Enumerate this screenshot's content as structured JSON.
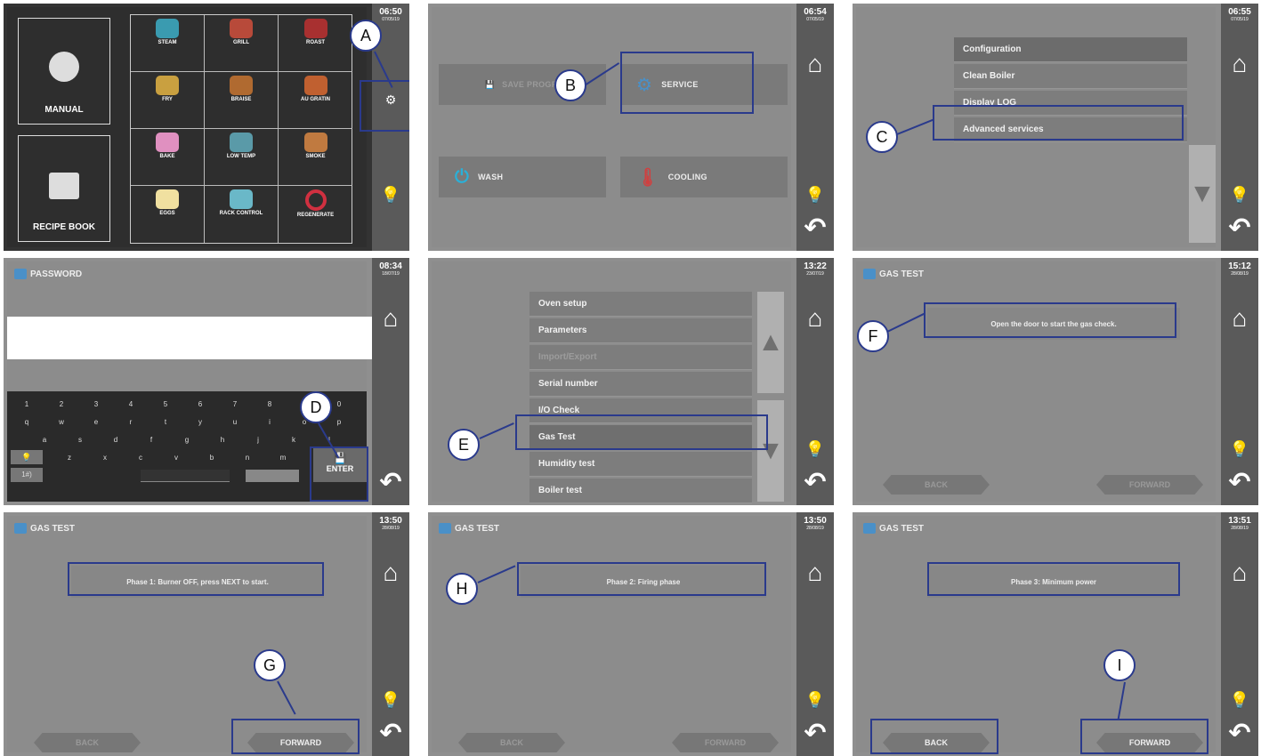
{
  "panel_a": {
    "clock": "06:50",
    "date": "07/05/19",
    "manual_label": "MANUAL",
    "recipe_label": "RECIPE BOOK",
    "cells": [
      "STEAM",
      "GRILL",
      "ROAST",
      "FRY",
      "BRAISE",
      "AU GRATIN",
      "BAKE",
      "LOW TEMP",
      "SMOKE",
      "EGGS",
      "RACK CONTROL",
      "REGENERATE"
    ],
    "callout": "A"
  },
  "panel_b": {
    "clock": "06:54",
    "date": "07/05/19",
    "save_label": "SAVE PROGR.",
    "service_label": "SERVICE",
    "wash_label": "WASH",
    "cooling_label": "COOLING",
    "callout": "B"
  },
  "panel_c": {
    "clock": "06:55",
    "date": "07/05/19",
    "items": [
      "Configuration",
      "Clean Boiler",
      "Display LOG",
      "Advanced services"
    ],
    "callout": "C"
  },
  "panel_d": {
    "clock": "08:34",
    "date": "18/07/19",
    "title": "PASSWORD",
    "row1": [
      "1",
      "2",
      "3",
      "4",
      "5",
      "6",
      "7",
      "8",
      "9",
      "0"
    ],
    "row2": [
      "q",
      "w",
      "e",
      "r",
      "t",
      "y",
      "u",
      "i",
      "o",
      "p"
    ],
    "row3": [
      "a",
      "s",
      "d",
      "f",
      "g",
      "h",
      "j",
      "k",
      "l"
    ],
    "row4": [
      "z",
      "x",
      "c",
      "v",
      "b",
      "n",
      "m"
    ],
    "sym_label": "1#)",
    "enter_label": "ENTER",
    "callout": "D"
  },
  "panel_e": {
    "clock": "13:22",
    "date": "23/07/19",
    "items": [
      "Oven setup",
      "Parameters",
      "Import/Export",
      "Serial number",
      "I/O Check",
      "Gas Test",
      "Humidity test",
      "Boiler test"
    ],
    "callout": "E"
  },
  "panel_f": {
    "clock": "15:12",
    "date": "28/08/19",
    "title": "GAS TEST",
    "message": "Open the door to start the gas check.",
    "back_label": "BACK",
    "forward_label": "FORWARD",
    "callout": "F"
  },
  "panel_g": {
    "clock": "13:50",
    "date": "28/08/19",
    "title": "GAS TEST",
    "message": "Phase 1: Burner OFF, press NEXT to start.",
    "back_label": "BACK",
    "forward_label": "FORWARD",
    "callout": "G"
  },
  "panel_h": {
    "clock": "13:50",
    "date": "28/08/19",
    "title": "GAS TEST",
    "message": "Phase 2: Firing phase",
    "back_label": "BACK",
    "forward_label": "FORWARD",
    "callout": "H"
  },
  "panel_i": {
    "clock": "13:51",
    "date": "28/08/19",
    "title": "GAS TEST",
    "message": "Phase 3: Minimum power",
    "back_label": "BACK",
    "forward_label": "FORWARD",
    "callout": "I"
  },
  "icons": {
    "home": "home-icon",
    "bulb": "lightbulb-icon",
    "back": "back-arrow-icon"
  },
  "colors": {
    "callout": "#2a3a8c",
    "panel": "#8c8c8c",
    "sidebar": "#5a5a5a",
    "accent_blue": "#4a90c8"
  }
}
